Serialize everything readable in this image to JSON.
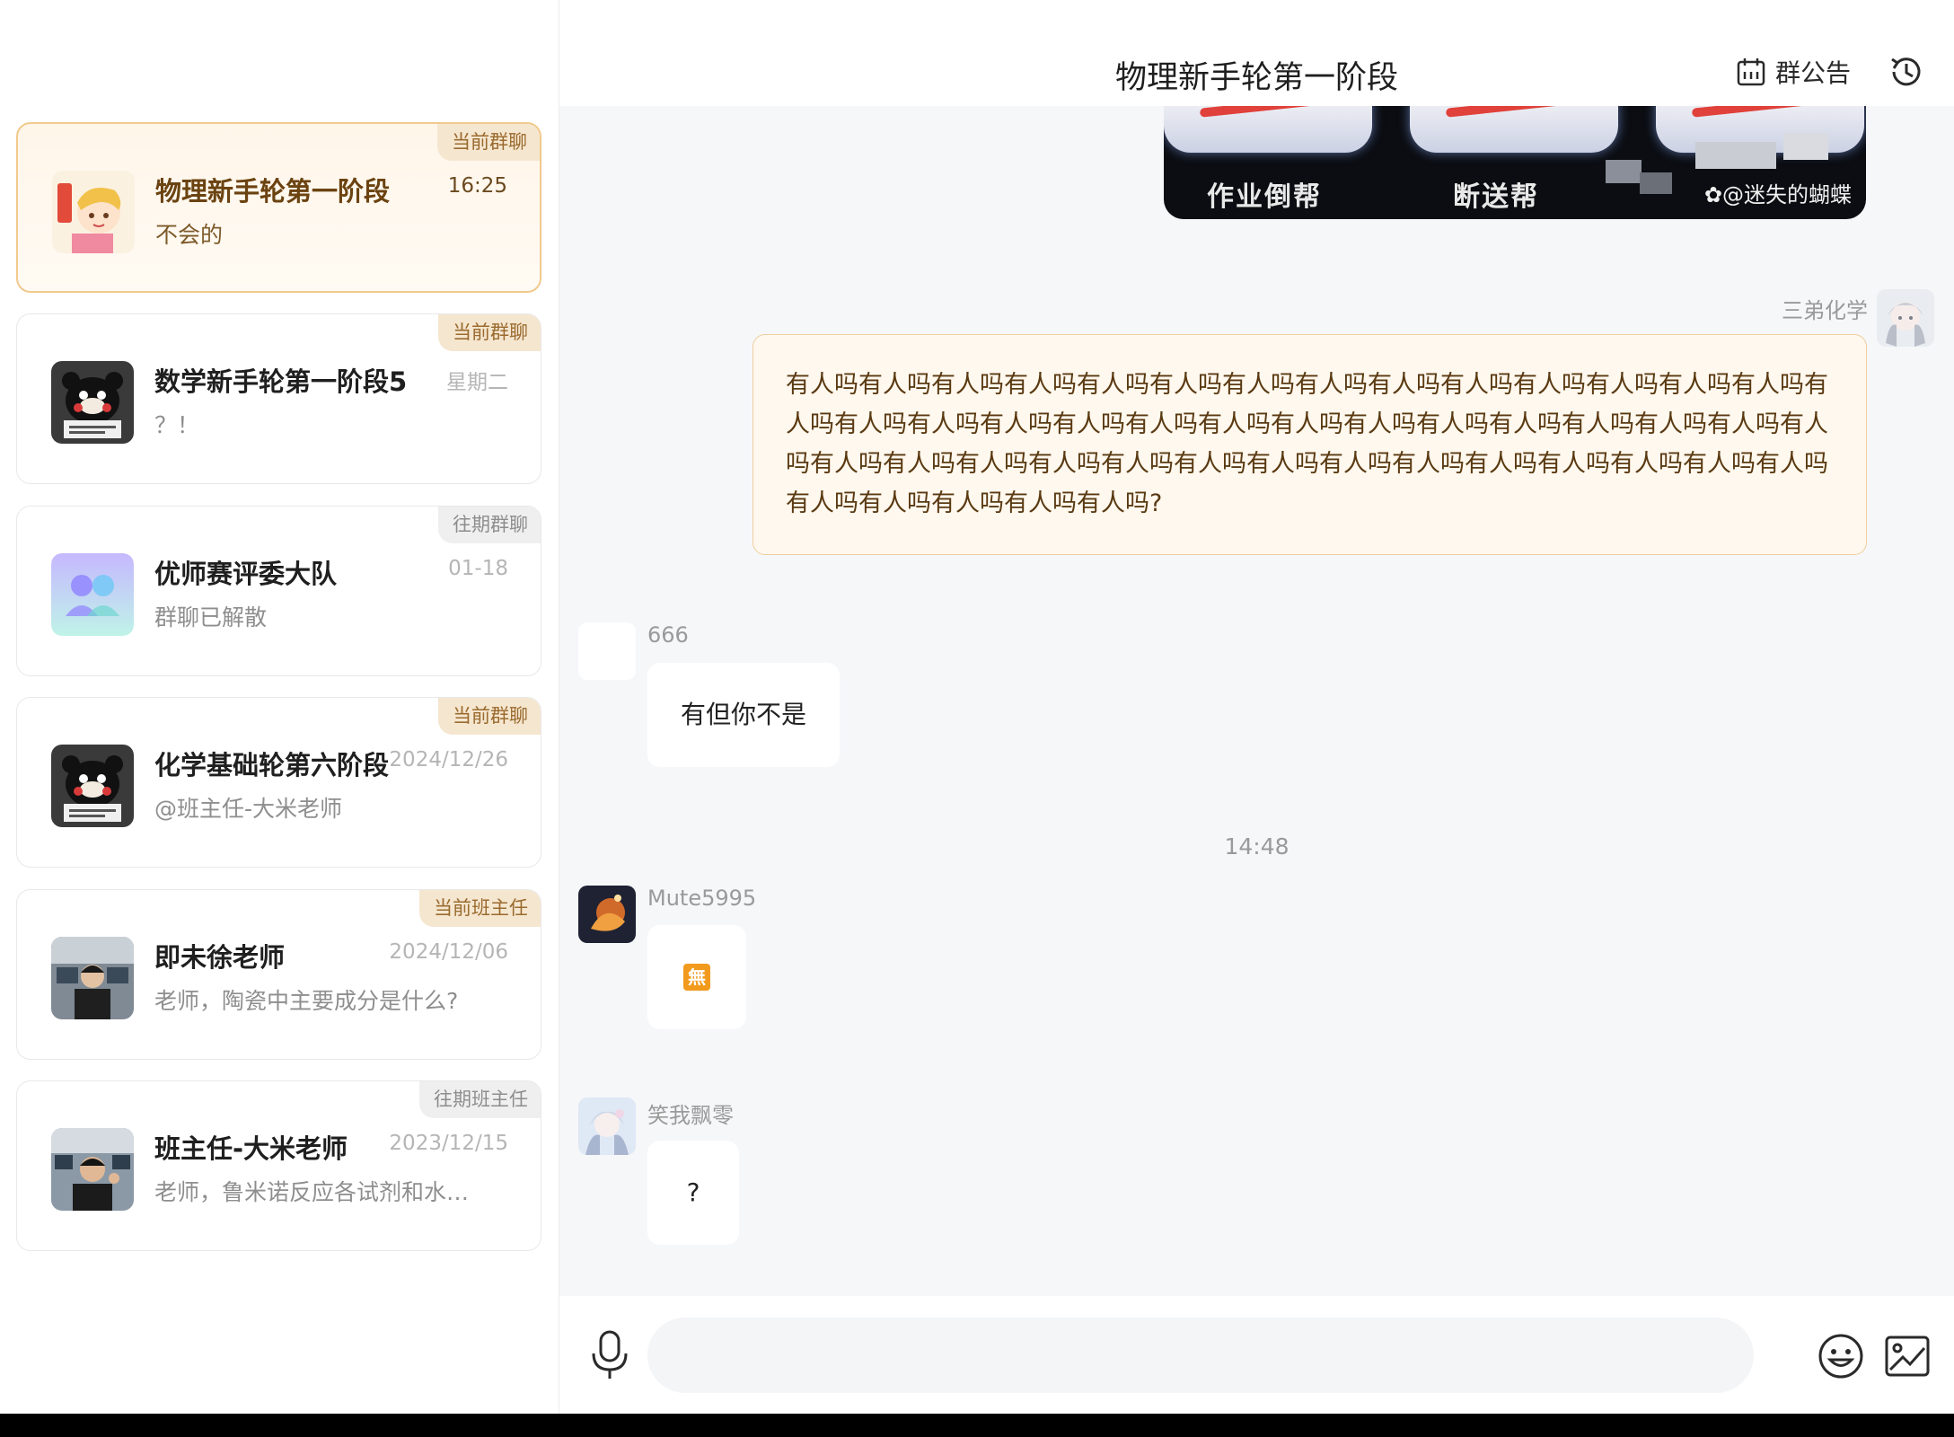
{
  "sidebar": {
    "conversations": [
      {
        "title": "物理新手轮第一阶段",
        "time": "16:25",
        "preview": "不会的",
        "badge": "当前群聊",
        "active": true
      },
      {
        "title": "数学新手轮第一阶段5",
        "time": "星期二",
        "preview": "？！",
        "badge": "当前群聊",
        "active": false
      },
      {
        "title": "优师赛评委大队",
        "time": "01-18",
        "preview": "群聊已解散",
        "badge": "往期群聊",
        "active": false
      },
      {
        "title": "化学基础轮第六阶段",
        "time": "2024/12/26",
        "preview": "@班主任-大米老师",
        "badge": "当前群聊",
        "active": false
      },
      {
        "title": "即未徐老师",
        "time": "2024/12/06",
        "preview": "老师，陶瓷中主要成分是什么?",
        "badge": "当前班主任",
        "active": false
      },
      {
        "title": "班主任-大米老师",
        "time": "2023/12/15",
        "preview": "老师，鲁米诺反应各试剂和水…",
        "badge": "往期班主任",
        "active": false
      }
    ]
  },
  "chat": {
    "title": "物理新手轮第一阶段",
    "announcement_label": "群公告",
    "shared_image": {
      "labels": [
        "作业倒帮",
        "断送帮"
      ],
      "watermark": "@迷失的蝴蝶"
    },
    "messages": {
      "mine": {
        "sender": "三弟化学",
        "text": "有人吗有人吗有人吗有人吗有人吗有人吗有人吗有人吗有人吗有人吗有人吗有人吗有人吗有人吗有人吗有人吗有人吗有人吗有人吗有人吗有人吗有人吗有人吗有人吗有人吗有人吗有人吗有人吗有人吗有人吗有人吗有人吗有人吗有人吗有人吗有人吗有人吗有人吗有人吗有人吗有人吗有人吗有人吗有人吗有人吗有人吗有人吗有人吗?"
      },
      "m1": {
        "sender": "666",
        "text": "有但你不是"
      },
      "timestamp": "14:48",
      "m2": {
        "sender": "Mute5995",
        "text": "無"
      },
      "m3": {
        "sender": "笑我飘零",
        "text": "?"
      }
    }
  },
  "input": {
    "placeholder": ""
  },
  "colors": {
    "accent_gold": "#f1c98d",
    "badge_text": "#9a6a2e",
    "active_title": "#6b4311",
    "emoji_orange": "#f29a1d"
  }
}
